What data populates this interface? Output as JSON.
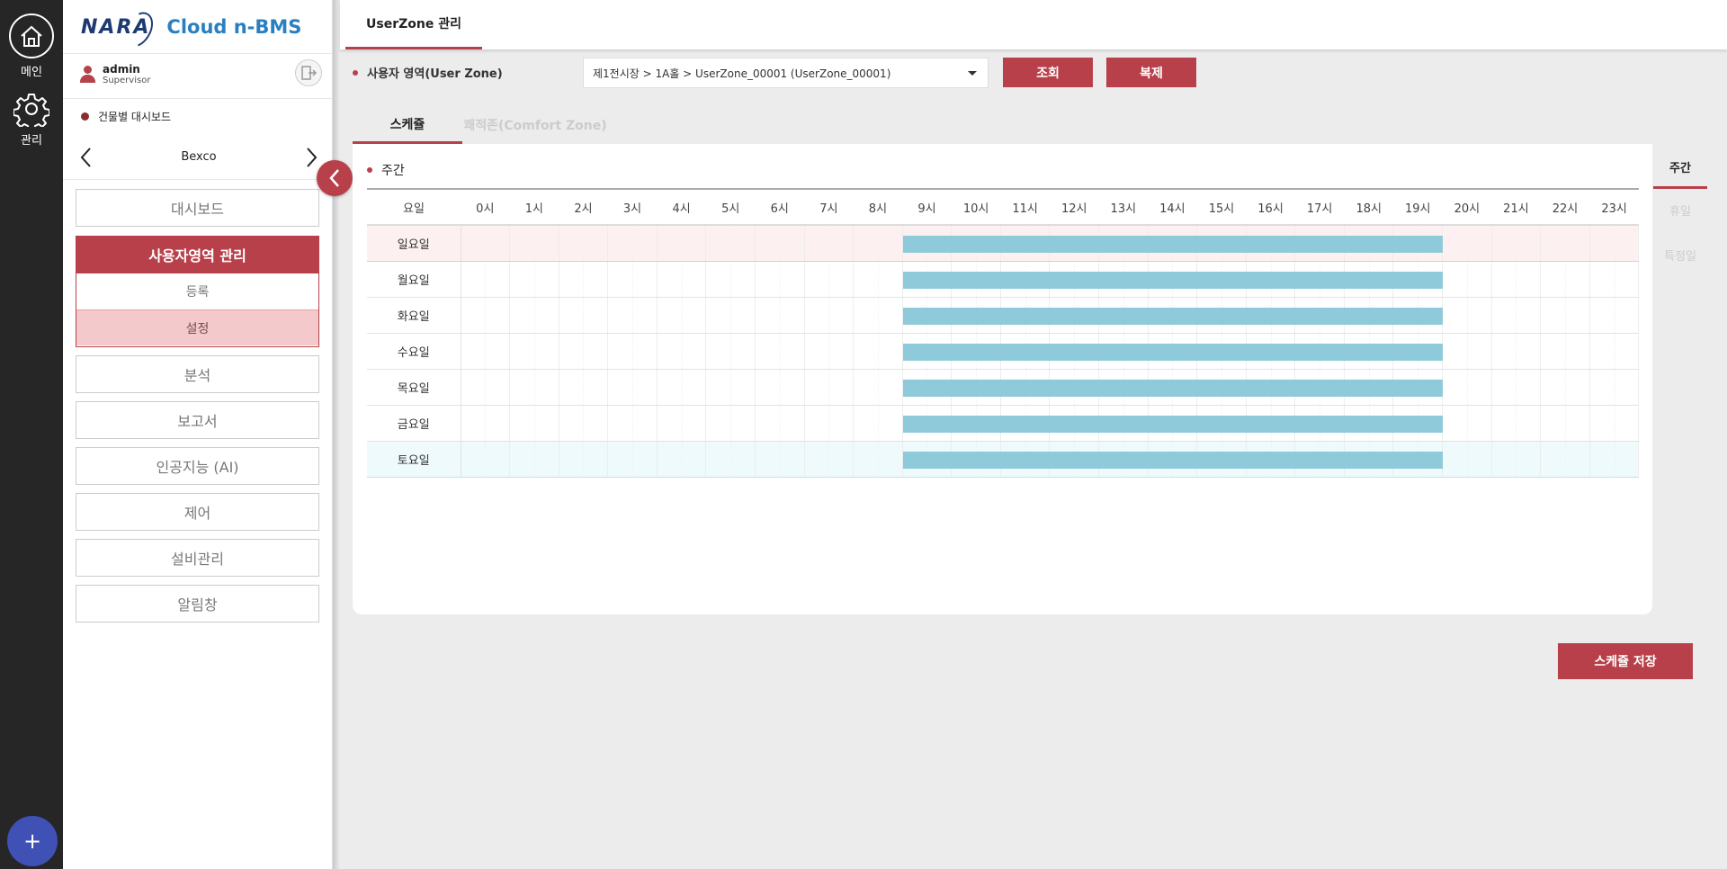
{
  "rail": {
    "home_label": "메인",
    "settings_label": "관리",
    "fab_label": "+"
  },
  "brand": {
    "logo_text": "NARA",
    "product": "Cloud n-BMS"
  },
  "user": {
    "name": "admin",
    "role": "Supervisor"
  },
  "building_dashboard": "건물별 대시보드",
  "building_name": "Bexco",
  "menu": {
    "dashboard": "대시보드",
    "userzone_mgmt": "사용자영역 관리",
    "register": "등록",
    "settings": "설정",
    "analysis": "분석",
    "report": "보고서",
    "ai": "인공지능 (AI)",
    "control": "제어",
    "equipment": "설비관리",
    "alerts": "알림창"
  },
  "top_tab": "UserZone 관리",
  "filter": {
    "label": "사용자 영역(User Zone)",
    "selected": "제1전시장 > 1A홀 > UserZone_00001 (UserZone_00001)",
    "search_btn": "조회",
    "copy_btn": "복제"
  },
  "tabs": {
    "schedule": "스케쥴",
    "comfort": "쾌적존(Comfort Zone)"
  },
  "section_label": "주간",
  "right_tabs": {
    "weekly": "주간",
    "holiday": "휴일",
    "special": "특정일"
  },
  "schedule": {
    "day_header": "요일",
    "hours": [
      "0시",
      "1시",
      "2시",
      "3시",
      "4시",
      "5시",
      "6시",
      "7시",
      "8시",
      "9시",
      "10시",
      "11시",
      "12시",
      "13시",
      "14시",
      "15시",
      "16시",
      "17시",
      "18시",
      "19시",
      "20시",
      "21시",
      "22시",
      "23시"
    ],
    "days": [
      {
        "name": "일요일",
        "start": 9,
        "end": 20
      },
      {
        "name": "월요일",
        "start": 9,
        "end": 20
      },
      {
        "name": "화요일",
        "start": 9,
        "end": 20
      },
      {
        "name": "수요일",
        "start": 9,
        "end": 20
      },
      {
        "name": "목요일",
        "start": 9,
        "end": 20
      },
      {
        "name": "금요일",
        "start": 9,
        "end": 20
      },
      {
        "name": "토요일",
        "start": 9,
        "end": 20
      }
    ]
  },
  "save_btn": "스케쥴 저장",
  "colors": {
    "accent": "#b8404a",
    "bar": "#8ecad9",
    "sunday_row": "#fdf0f1",
    "saturday_row": "#eefafc"
  }
}
